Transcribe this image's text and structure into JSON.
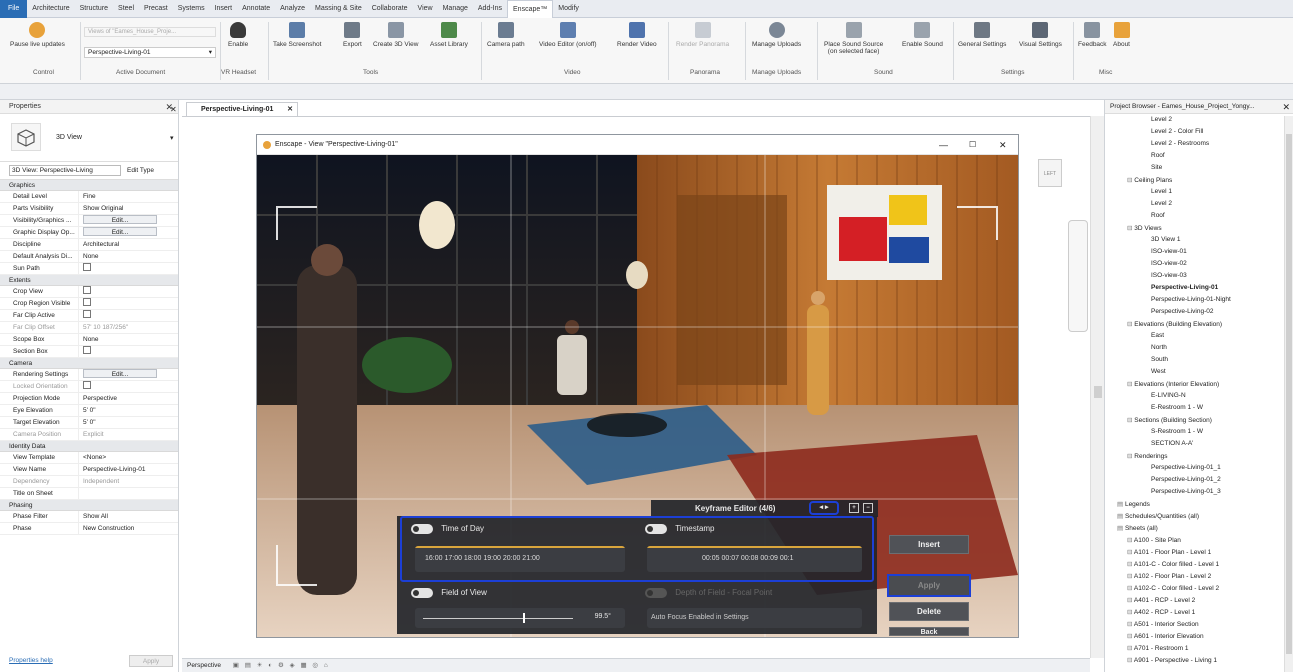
{
  "menubar": {
    "items": [
      "File",
      "Architecture",
      "Structure",
      "Steel",
      "Precast",
      "Systems",
      "Insert",
      "Annotate",
      "Analyze",
      "Massing & Site",
      "Collaborate",
      "View",
      "Manage",
      "Add-Ins",
      "Enscape™",
      "Modify"
    ]
  },
  "ribbon": {
    "pause_label": "Pause live updates",
    "doc_placeholder": "Views of \"Eames_House_Proje...",
    "doc_select": "Perspective-Living-01",
    "enable_label": "Enable",
    "screenshot_label": "Take Screenshot",
    "export_label": "Export",
    "create3d_label": "Create 3D View",
    "asset_label": "Asset Library",
    "camerapath_label": "Camera path",
    "videoeditor_label": "Video Editor (on/off)",
    "rendervideo_label": "Render Video",
    "renderpano_label": "Render Panorama",
    "manageuploads1_label": "Manage Uploads",
    "placesound_label": "Place Sound Source",
    "placesound_sub": "(on selected face)",
    "enablesound_label": "Enable Sound",
    "general_label": "General Settings",
    "visual_label": "Visual Settings",
    "feedback_label": "Feedback",
    "about_label": "About",
    "groups": {
      "control": "Control",
      "active_doc": "Active Document",
      "vr": "VR Headset",
      "tools": "Tools",
      "video": "Video",
      "panorama": "Panorama",
      "manage": "Manage Uploads",
      "sound": "Sound",
      "settings": "Settings",
      "misc": "Misc"
    }
  },
  "properties": {
    "title": "Properties",
    "type_name": "3D View",
    "selector": "3D View: Perspective-Living",
    "edit_type": "Edit Type",
    "sections": {
      "graphics": "Graphics",
      "extents": "Extents",
      "camera": "Camera",
      "identity": "Identity Data",
      "phasing": "Phasing"
    },
    "graphics": [
      [
        "Detail Level",
        "Fine"
      ],
      [
        "Parts Visibility",
        "Show Original"
      ],
      [
        "Visibility/Graphics ...",
        "Edit..."
      ],
      [
        "Graphic Display Op...",
        "Edit..."
      ],
      [
        "Discipline",
        "Architectural"
      ],
      [
        "Default Analysis Di...",
        "None"
      ],
      [
        "Sun Path",
        ""
      ]
    ],
    "extents": [
      [
        "Crop View",
        ""
      ],
      [
        "Crop Region Visible",
        ""
      ],
      [
        "Far Clip Active",
        ""
      ],
      [
        "Far Clip Offset",
        "57' 10 187/256\""
      ],
      [
        "Scope Box",
        "None"
      ],
      [
        "Section Box",
        ""
      ]
    ],
    "camera": [
      [
        "Rendering Settings",
        "Edit..."
      ],
      [
        "Locked Orientation",
        ""
      ],
      [
        "Projection Mode",
        "Perspective"
      ],
      [
        "Eye Elevation",
        "5' 0\""
      ],
      [
        "Target Elevation",
        "5' 0\""
      ],
      [
        "Camera Position",
        "Explicit"
      ]
    ],
    "identity": [
      [
        "View Template",
        "<None>"
      ],
      [
        "View Name",
        "Perspective-Living-01"
      ],
      [
        "Dependency",
        "Independent"
      ],
      [
        "Title on Sheet",
        ""
      ]
    ],
    "phasing": [
      [
        "Phase Filter",
        "Show All"
      ],
      [
        "Phase",
        "New Construction"
      ]
    ],
    "help_link": "Properties help",
    "apply": "Apply"
  },
  "view_tab": "Perspective-Living-01",
  "enscape": {
    "title": "Enscape - View \"Perspective-Living-01\"",
    "keyframe_label": "Keyframe Editor (4/6)",
    "time_of_day": "Time of Day",
    "timestamp": "Timestamp",
    "time_ticks": "16:00 17:00 18:00 19:00 20:00 21:00",
    "stamp_ticks": "00:05 00:07 00:08 00:09 00:1",
    "fov": "Field of View",
    "fov_value": "99.5°",
    "depth": "Depth of Field - Focal Point",
    "autofocus": "Auto Focus Enabled in Settings",
    "insert": "Insert",
    "apply": "Apply",
    "delete": "Delete",
    "back": "Back",
    "viewcube": "LEFT"
  },
  "status": {
    "perspective": "Perspective"
  },
  "browser": {
    "title": "Project Browser - Eames_House_Project_Yongy...",
    "items": [
      {
        "t": "Level 2",
        "d": 3
      },
      {
        "t": "Level 2 - Color Fill",
        "d": 3
      },
      {
        "t": "Level 2 - Restrooms",
        "d": 3
      },
      {
        "t": "Roof",
        "d": 3
      },
      {
        "t": "Site",
        "d": 3
      },
      {
        "t": "Ceiling Plans",
        "d": 2
      },
      {
        "t": "Level 1",
        "d": 3
      },
      {
        "t": "Level 2",
        "d": 3
      },
      {
        "t": "Roof",
        "d": 3
      },
      {
        "t": "3D Views",
        "d": 2
      },
      {
        "t": "3D View 1",
        "d": 3
      },
      {
        "t": "ISO-view-01",
        "d": 3
      },
      {
        "t": "ISO-view-02",
        "d": 3
      },
      {
        "t": "ISO-view-03",
        "d": 3
      },
      {
        "t": "Perspective-Living-01",
        "d": 3,
        "b": true
      },
      {
        "t": "Perspective-Living-01-Night",
        "d": 3
      },
      {
        "t": "Perspective-Living-02",
        "d": 3
      },
      {
        "t": "Elevations (Building Elevation)",
        "d": 2
      },
      {
        "t": "East",
        "d": 3
      },
      {
        "t": "North",
        "d": 3
      },
      {
        "t": "South",
        "d": 3
      },
      {
        "t": "West",
        "d": 3
      },
      {
        "t": "Elevations (Interior Elevation)",
        "d": 2
      },
      {
        "t": "E-LIVING-N",
        "d": 3
      },
      {
        "t": "E-Restroom 1 - W",
        "d": 3
      },
      {
        "t": "Sections (Building Section)",
        "d": 2
      },
      {
        "t": "S-Restroom 1 - W",
        "d": 3
      },
      {
        "t": "SECTION A-A'",
        "d": 3
      },
      {
        "t": "Renderings",
        "d": 2
      },
      {
        "t": "Perspective-Living-01_1",
        "d": 3
      },
      {
        "t": "Perspective-Living-01_2",
        "d": 3
      },
      {
        "t": "Perspective-Living-01_3",
        "d": 3
      },
      {
        "t": "Legends",
        "d": 1
      },
      {
        "t": "Schedules/Quantities (all)",
        "d": 1
      },
      {
        "t": "Sheets (all)",
        "d": 1
      },
      {
        "t": "A100 - Site Plan",
        "d": 2
      },
      {
        "t": "A101 - Floor Plan - Level 1",
        "d": 2
      },
      {
        "t": "A101-C - Color filled - Level 1",
        "d": 2
      },
      {
        "t": "A102 - Floor Plan - Level 2",
        "d": 2
      },
      {
        "t": "A102-C - Color filled - Level 2",
        "d": 2
      },
      {
        "t": "A401 - RCP - Level 2",
        "d": 2
      },
      {
        "t": "A402 - RCP - Level 1",
        "d": 2
      },
      {
        "t": "A501 - Interior Section",
        "d": 2
      },
      {
        "t": "A601 - Interior Elevation",
        "d": 2
      },
      {
        "t": "A701 - Restroom 1",
        "d": 2
      },
      {
        "t": "A901 - Perspective - Living 1",
        "d": 2
      }
    ]
  }
}
